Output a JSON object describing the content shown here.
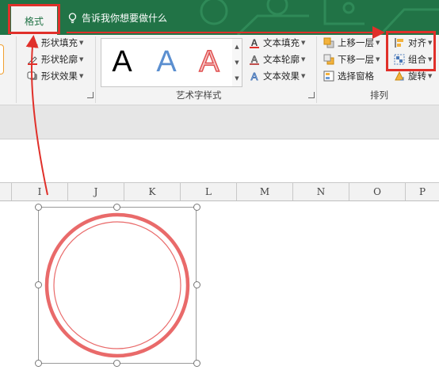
{
  "title_bar": {
    "active_tab": "格式",
    "tell_me": "告诉我你想要做什么"
  },
  "ribbon": {
    "shape_styles": {
      "fill": "形状填充",
      "outline": "形状轮廓",
      "effects": "形状效果"
    },
    "wordart_styles": {
      "gallery": [
        "A",
        "A",
        "A"
      ],
      "text_fill": "文本填充",
      "text_outline": "文本轮廓",
      "text_effects": "文本效果",
      "label": "艺术字样式"
    },
    "arrange": {
      "bring_forward": "上移一层",
      "send_backward": "下移一层",
      "selection_pane": "选择窗格",
      "align": "对齐",
      "group": "组合",
      "rotate": "旋转",
      "label": "排列"
    }
  },
  "sheet": {
    "columns": [
      "I",
      "J",
      "K",
      "L",
      "M",
      "N",
      "O",
      "P"
    ]
  },
  "colors": {
    "ribbon_green": "#217346",
    "highlight_red": "#e0302a",
    "ring_red": "#e96a6a"
  },
  "icons": {
    "tell_me": "lightbulb-icon",
    "shape_fill": "paint-bucket-icon",
    "shape_outline": "pencil-outline-icon",
    "shape_effects": "shape-effects-icon",
    "text_fill": "text-fill-a-icon",
    "text_outline": "text-outline-a-icon",
    "text_effects": "text-effects-a-icon",
    "bring_forward": "bring-forward-icon",
    "send_backward": "send-backward-icon",
    "selection_pane": "selection-pane-icon",
    "align": "align-icon",
    "group": "group-icon",
    "rotate": "rotate-icon"
  }
}
